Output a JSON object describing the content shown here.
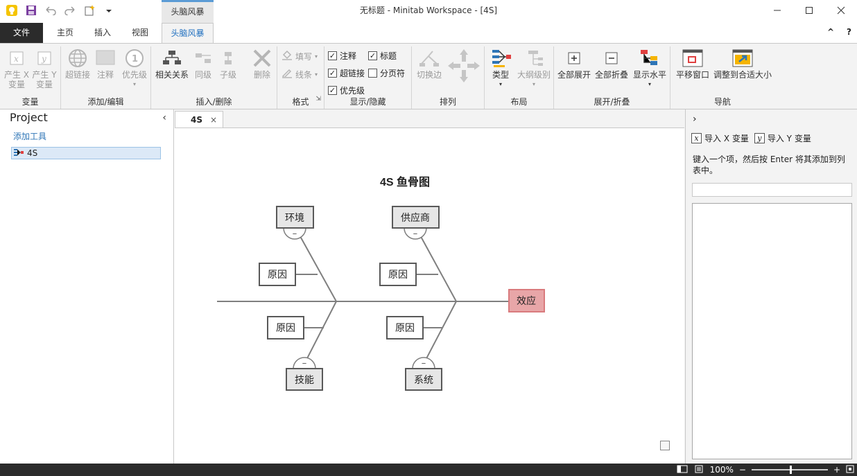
{
  "window": {
    "title": "无标题 - Minitab Workspace - [4S]",
    "context_tab_header": "头脑风暴"
  },
  "tabs": {
    "file": "文件",
    "home": "主页",
    "insert": "插入",
    "view": "视图",
    "brainstorm": "头脑风暴",
    "collapse_ribbon": "^",
    "help": "?"
  },
  "ribbon": {
    "variables": {
      "label": "变量",
      "x_line1": "产生 X",
      "x_line2": "变量",
      "y_line1": "产生 Y",
      "y_line2": "变量"
    },
    "add_edit": {
      "label": "添加/编辑",
      "hyperlink": "超链接",
      "note": "注释",
      "priority": "优先级"
    },
    "insert_delete": {
      "label": "插入/删除",
      "related": "相关关系",
      "same_level": "同级",
      "child": "子级",
      "delete": "删除"
    },
    "format": {
      "label": "格式",
      "fill": "填写",
      "line": "线条"
    },
    "show_hide": {
      "label": "显示/隐藏",
      "notes": "注释",
      "title": "标题",
      "hyperlinks": "超链接",
      "page_break": "分页符",
      "priority": "优先级"
    },
    "arrange": {
      "label": "排列",
      "toggle_edges": "切换边"
    },
    "layout": {
      "label": "布局",
      "type": "类型",
      "outline_level": "大纲级别"
    },
    "expand_collapse": {
      "label": "展开/折叠",
      "expand_all": "全部展开",
      "collapse_all": "全部折叠",
      "show_level": "显示水平"
    },
    "navigation": {
      "label": "导航",
      "pan_window": "平移窗口",
      "fit": "调整到合适大小"
    }
  },
  "project": {
    "title": "Project",
    "add_tool": "添加工具",
    "items": [
      {
        "label": "4S"
      }
    ]
  },
  "document": {
    "tab_label": "4S",
    "close_glyph": "×"
  },
  "diagram": {
    "title": "4S 鱼骨图",
    "effect": "效应",
    "categories": [
      "环境",
      "供应商",
      "技能",
      "系统"
    ],
    "cause_label": "原因",
    "collapse_glyph": "−"
  },
  "rightpane": {
    "import_x": "导入 X 变量",
    "import_y": "导入 Y 变量",
    "hint": "键入一个项，然后按 Enter 将其添加到列表中。",
    "input_value": ""
  },
  "statusbar": {
    "zoom": "100%"
  },
  "colors": {
    "accent": "#1f6fbf",
    "effect_fill": "#e8a6a8",
    "effect_border": "#d97a7d",
    "category_fill": "#e6e6e6",
    "dark_bar": "#2b2b2b"
  }
}
